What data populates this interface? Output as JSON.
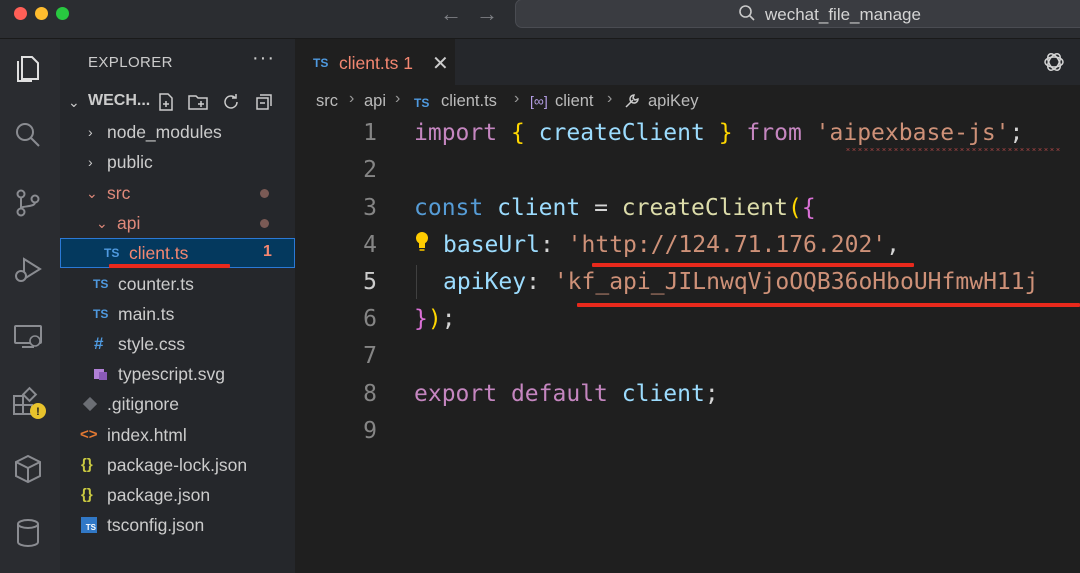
{
  "window": {
    "title": "wechat_file_manage"
  },
  "sidebar": {
    "title": "EXPLORER",
    "more": "···",
    "workspace": "WECH...",
    "tree": [
      {
        "label": "node_modules",
        "type": "folder"
      },
      {
        "label": "public",
        "type": "folder"
      },
      {
        "label": "src",
        "type": "folder",
        "modified": true
      },
      {
        "label": "api",
        "type": "folder",
        "modified": true
      },
      {
        "label": "client.ts",
        "type": "ts",
        "badge": "1",
        "selected": true
      },
      {
        "label": "counter.ts",
        "type": "ts"
      },
      {
        "label": "main.ts",
        "type": "ts"
      },
      {
        "label": "style.css",
        "type": "css"
      },
      {
        "label": "typescript.svg",
        "type": "svg"
      },
      {
        "label": ".gitignore",
        "type": "git"
      },
      {
        "label": "index.html",
        "type": "html"
      },
      {
        "label": "package-lock.json",
        "type": "json"
      },
      {
        "label": "package.json",
        "type": "json"
      },
      {
        "label": "tsconfig.json",
        "type": "tsconfig"
      }
    ]
  },
  "editor": {
    "tab": {
      "label": "client.ts",
      "badge": "1",
      "icon": "TS",
      "close": "✕"
    },
    "breadcrumb": [
      "src",
      "api",
      "client.ts",
      "client",
      "apiKey"
    ],
    "breadcrumb_icon_ts": "TS",
    "line_numbers": [
      "1",
      "2",
      "3",
      "4",
      "5",
      "6",
      "7",
      "8",
      "9"
    ],
    "code": {
      "l1_import": "import",
      "l1_open": "{",
      "l1_name": "createClient",
      "l1_close": "}",
      "l1_from": "from",
      "l1_module": "'aipexbase-js'",
      "l1_semi": ";",
      "l3_const": "const",
      "l3_var": "client",
      "l3_eq": "=",
      "l3_fn": "createClient",
      "l3_paren": "(",
      "l3_brace": "{",
      "l4_key": "baseUrl",
      "l4_colon": ":",
      "l4_value": "'http://124.71.176.202'",
      "l4_comma": ",",
      "l5_key": "apiKey",
      "l5_colon": ":",
      "l5_value": "'kf_api_JILnwqVjoOQB36oHboUHfmwH11j",
      "l6_brace": "}",
      "l6_paren": ")",
      "l6_semi": ";",
      "l8_export": "export",
      "l8_default": "default",
      "l8_var": "client",
      "l8_semi": ";"
    }
  },
  "colors": {
    "highlight_underline": "#e8291c",
    "selection": "#04395e"
  }
}
